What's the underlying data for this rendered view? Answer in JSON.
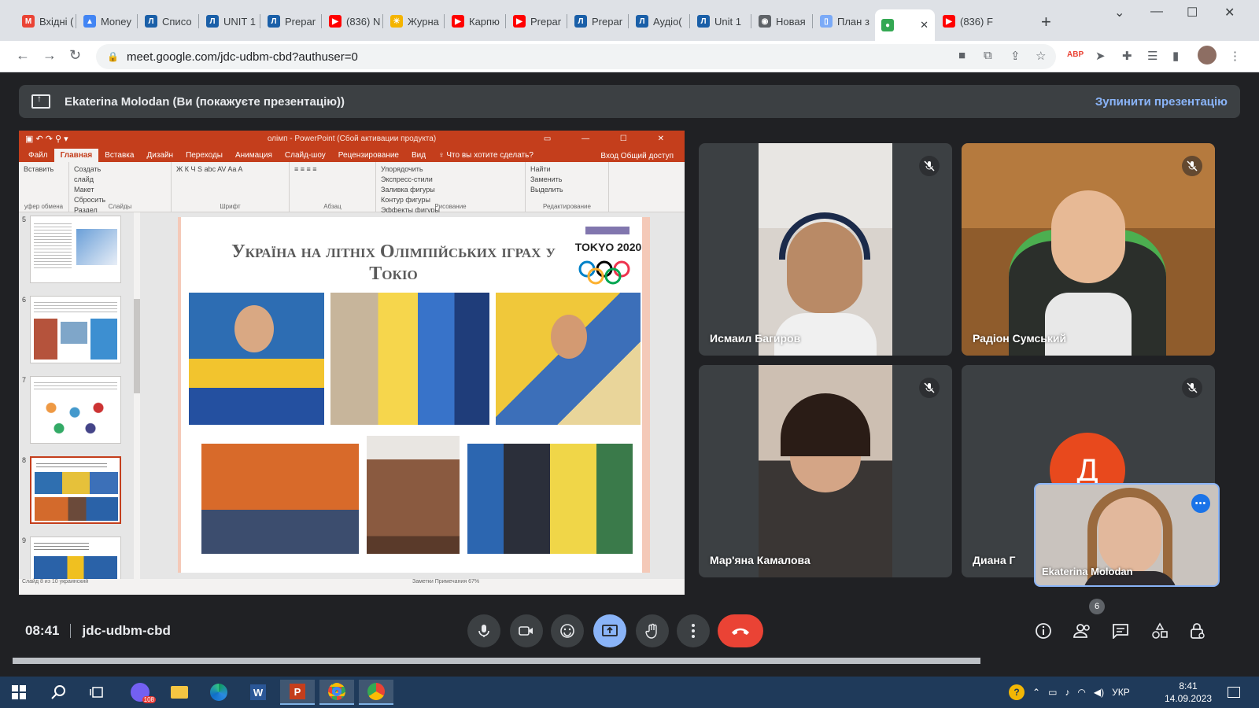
{
  "browser": {
    "tabs": [
      {
        "label": "Вхідні (",
        "fav": "M",
        "color": "#ea4335"
      },
      {
        "label": "Money",
        "fav": "▲",
        "color": "#4285f4"
      },
      {
        "label": "Списо",
        "fav": "Л",
        "color": "#1a5fa8"
      },
      {
        "label": "UNIT 1",
        "fav": "Л",
        "color": "#1a5fa8"
      },
      {
        "label": "Prepar",
        "fav": "Л",
        "color": "#1a5fa8"
      },
      {
        "label": "(836) N",
        "fav": "▶",
        "color": "#ff0000"
      },
      {
        "label": "Журна",
        "fav": "☀",
        "color": "#f4b400"
      },
      {
        "label": "Карпю",
        "fav": "▶",
        "color": "#ff0000"
      },
      {
        "label": "Prepar",
        "fav": "▶",
        "color": "#ff0000"
      },
      {
        "label": "Prepar",
        "fav": "Л",
        "color": "#1a5fa8"
      },
      {
        "label": "Аудіо(",
        "fav": "Л",
        "color": "#1a5fa8"
      },
      {
        "label": "Unit 1",
        "fav": "Л",
        "color": "#1a5fa8"
      },
      {
        "label": "Новая",
        "fav": "◉",
        "color": "#5f6368"
      },
      {
        "label": "План з",
        "fav": "▯",
        "color": "#7baaf7"
      },
      {
        "label": "",
        "fav": "●",
        "color": "#34a853"
      },
      {
        "label": "(836) F",
        "fav": "▶",
        "color": "#ff0000"
      }
    ],
    "url": "meet.google.com/jdc-udbm-cbd?authuser=0"
  },
  "meet": {
    "presenting_label": "Ekaterina Molodan (Ви (покажуєте презентацію))",
    "stop_label": "Зупинити презентацію",
    "time": "08:41",
    "meeting_code": "jdc-udbm-cbd",
    "people_count": "6",
    "participants": [
      {
        "name": "Исмаил Багиров"
      },
      {
        "name": "Радіон Сумський"
      },
      {
        "name": "Мар'яна Камалова"
      },
      {
        "name": "Диана Г"
      }
    ],
    "avatar_letter": "Д",
    "self_name": "Ekaterina Molodan",
    "colors": {
      "accent": "#8ab4f8",
      "end_call": "#ea4335",
      "avatar": "#e8491d"
    }
  },
  "ppt": {
    "window_title": "олімп - PowerPoint (Сбой активации продукта)",
    "menu": [
      "Файл",
      "Главная",
      "Вставка",
      "Дизайн",
      "Переходы",
      "Анимация",
      "Слайд-шоу",
      "Рецензирование",
      "Вид",
      "♀ Что вы хотите сделать?"
    ],
    "menu_right": "Вход   Общий доступ",
    "ribbon_groups": [
      {
        "items": [
          "Вставить"
        ],
        "label": "уфер обмена"
      },
      {
        "items": [
          "Создать",
          "слайд",
          "Макет",
          "Сбросить",
          "Раздел"
        ],
        "label": "Слайды"
      },
      {
        "items": [
          "Ж К Ч S abc AV Aa A"
        ],
        "label": "Шрифт"
      },
      {
        "items": [
          "≡ ≡ ≡ ≡"
        ],
        "label": "Абзац"
      },
      {
        "items": [
          "Упорядочить",
          "Экспресс-стили",
          "Заливка фигуры",
          "Контур фигуры",
          "Эффекты фигуры"
        ],
        "label": "Рисование"
      },
      {
        "items": [
          "Найти",
          "Заменить",
          "Выделить"
        ],
        "label": "Редактирование"
      }
    ],
    "thumbnail_numbers": [
      "5",
      "6",
      "7",
      "8",
      "9"
    ],
    "slide_title": "Україна на літніх Олімпійських іграх у Токіо",
    "logo_text": "TOKYO 2020",
    "status_left": "Слайд 8 из 10   украинский",
    "status_right": "Заметки   Примечания   67%"
  },
  "taskbar": {
    "lang": "УКР",
    "time": "8:41",
    "date": "14.09.2023",
    "viber_badge": "108"
  }
}
